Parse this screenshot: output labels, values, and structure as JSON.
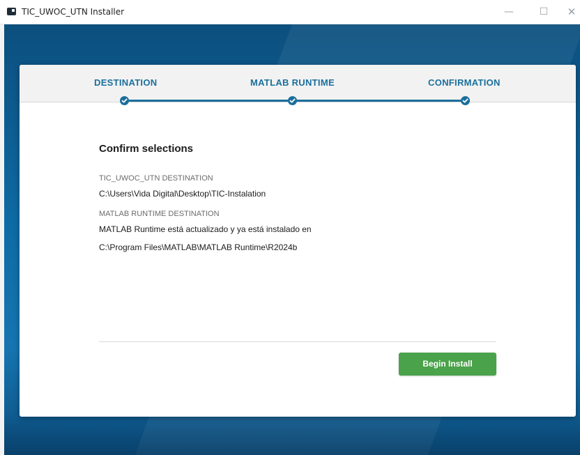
{
  "window": {
    "title": "TIC_UWOC_UTN Installer",
    "app_icon": "installer-app-icon",
    "controls": {
      "minimize": "—",
      "maximize": "☐",
      "close": "✕"
    }
  },
  "steps": [
    {
      "label": "DESTINATION",
      "state": "complete",
      "icon": "checkmark-icon"
    },
    {
      "label": "MATLAB RUNTIME",
      "state": "complete",
      "icon": "checkmark-icon"
    },
    {
      "label": "CONFIRMATION",
      "state": "complete",
      "icon": "checkmark-icon"
    }
  ],
  "confirm": {
    "heading": "Confirm selections",
    "app_dest_label": "TIC_UWOC_UTN DESTINATION",
    "app_dest_value": "C:\\Users\\Vida Digital\\Desktop\\TIC-Instalation",
    "runtime_label": "MATLAB RUNTIME DESTINATION",
    "runtime_status": "MATLAB Runtime está actualizado y ya está instalado en",
    "runtime_path": "C:\\Program Files\\MATLAB\\MATLAB Runtime\\R2024b"
  },
  "actions": {
    "begin_install": "Begin Install"
  },
  "colors": {
    "accent": "#1a6f9c",
    "install_button": "#4aa24a",
    "backdrop": "#0e6aa3"
  }
}
